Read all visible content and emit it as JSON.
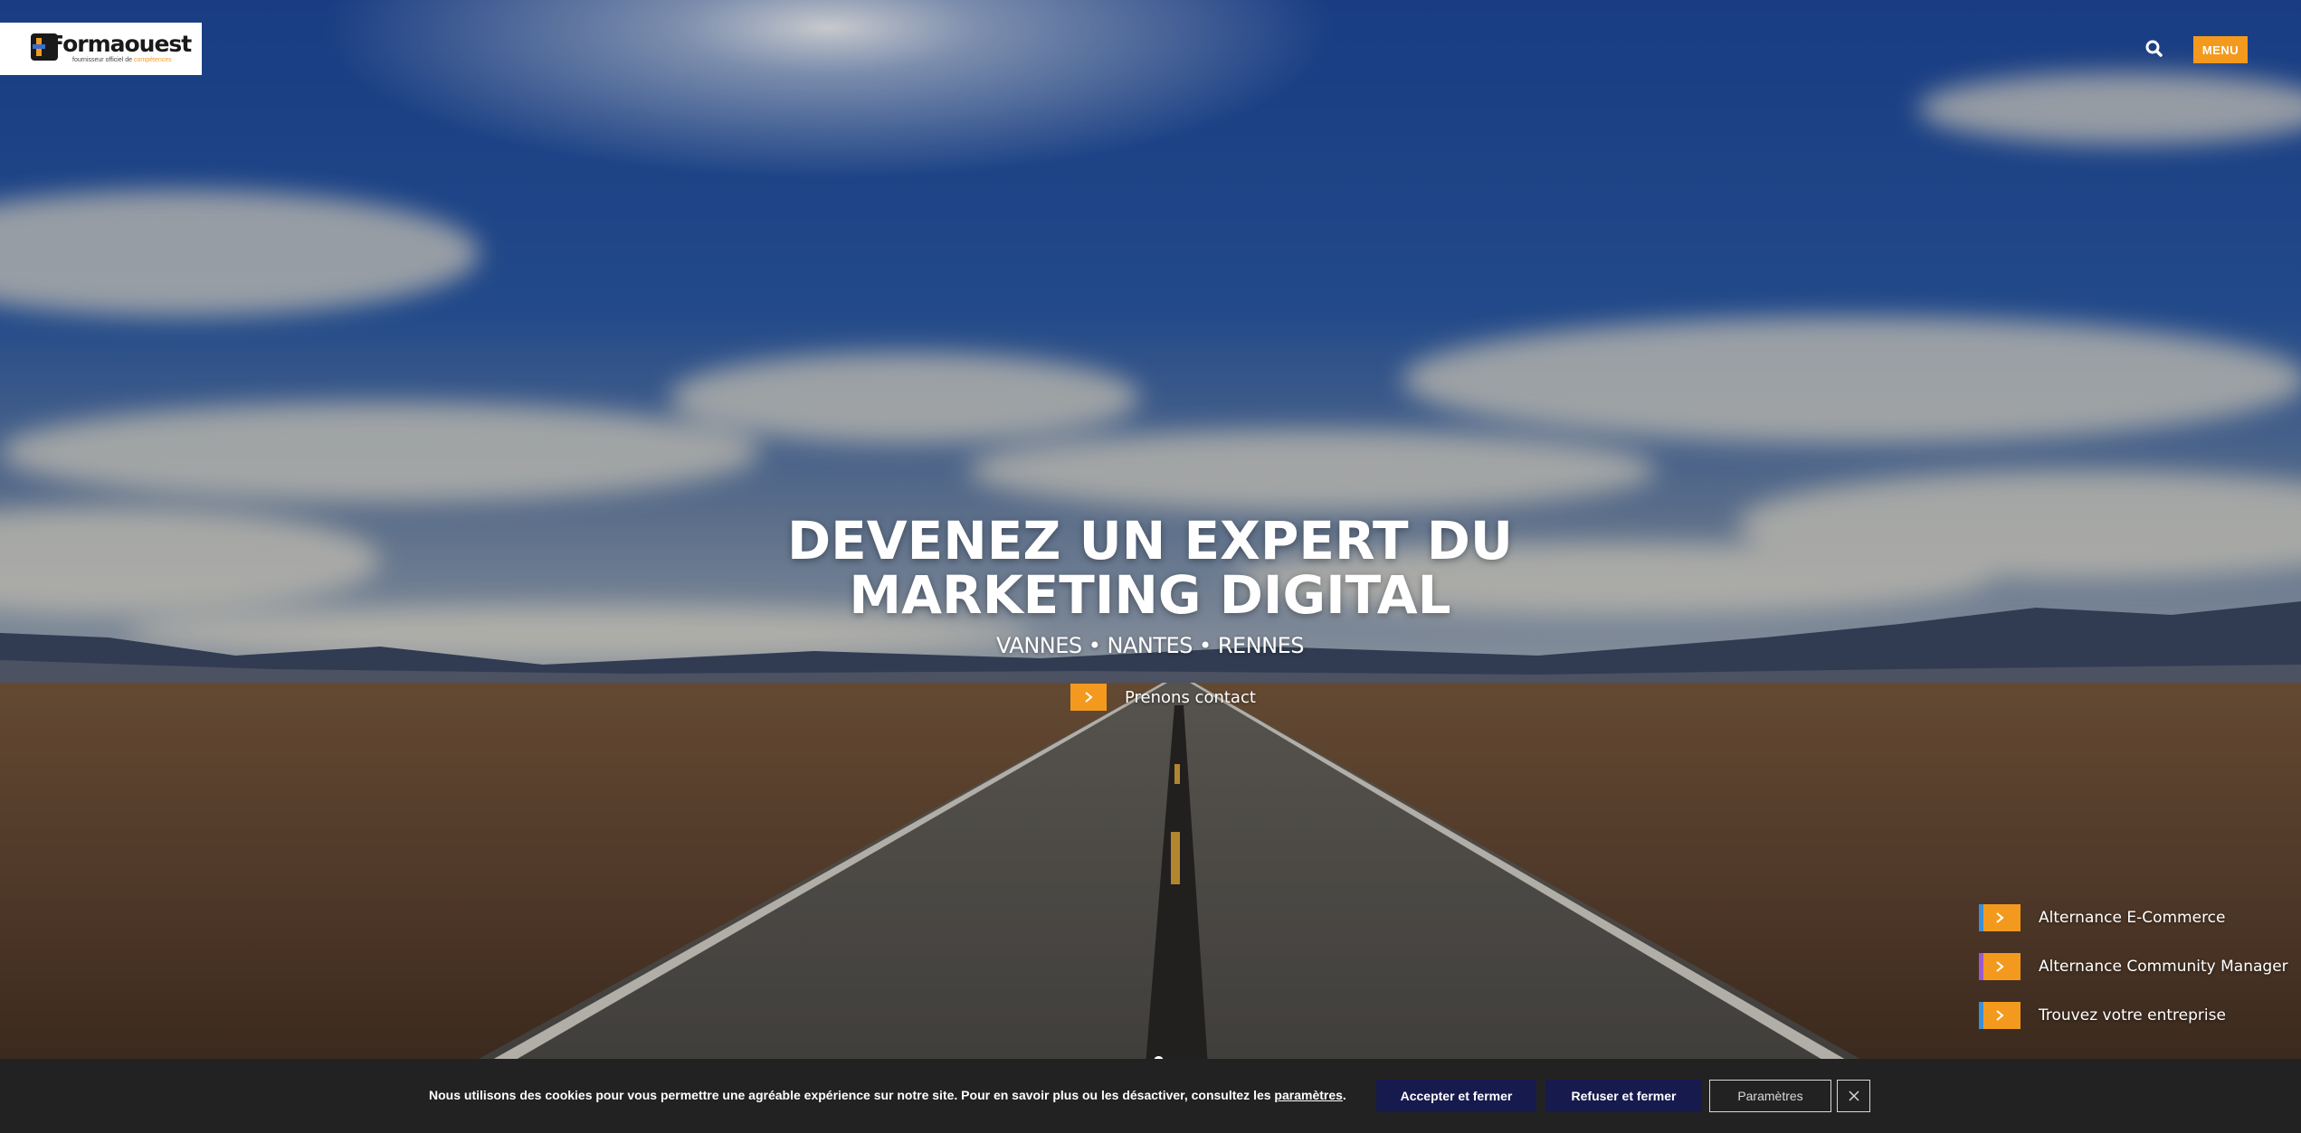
{
  "header": {
    "logo_name": "Formaouest",
    "logo_tagline_prefix": "fournisseur officiel de",
    "logo_tagline_highlight": "compétences",
    "search_icon": "search-icon",
    "menu_label": "MENU"
  },
  "hero": {
    "title_line1": "DEVENEZ UN EXPERT DU",
    "title_line2": "MARKETING DIGITAL",
    "subtitle": "VANNES • NANTES • RENNES",
    "cta_label": "Prenons contact",
    "cta_icon": "chevron-right-icon"
  },
  "quick_links": [
    {
      "label": "Alternance E-Commerce",
      "stripe_color": "#3a8fd9",
      "icon": "chevron-right-icon"
    },
    {
      "label": "Alternance Community Manager",
      "stripe_color": "#9b59d0",
      "icon": "chevron-right-icon"
    },
    {
      "label": "Trouvez votre entreprise",
      "stripe_color": "#3a8fd9",
      "icon": "chevron-right-icon"
    }
  ],
  "cookie_bar": {
    "text": "Nous utilisons des cookies pour vous permettre une agréable expérience sur notre site. Pour en savoir plus ou les désactiver, consultez les ",
    "link_label": "paramètres",
    "text_end": ".",
    "accept_label": "Accepter et fermer",
    "refuse_label": "Refuser et fermer",
    "params_label": "Paramètres",
    "close_icon": "close-icon"
  },
  "colors": {
    "accent": "#f39a1e",
    "cookie_bg": "#222222",
    "cookie_button": "#171a4d"
  }
}
